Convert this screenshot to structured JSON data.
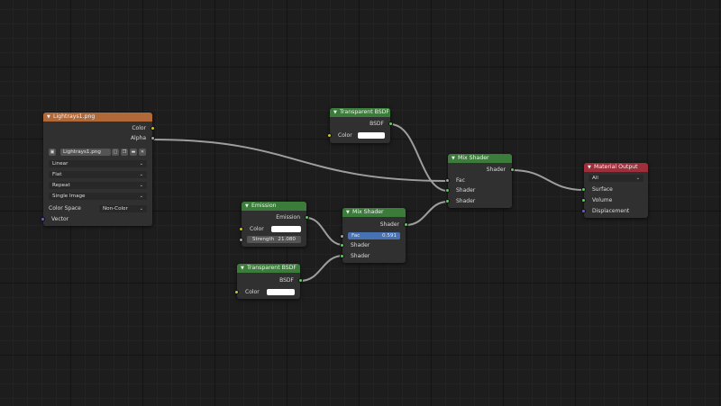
{
  "image_node": {
    "title": "Lightrays1.png",
    "outputs": [
      "Color",
      "Alpha"
    ],
    "image_name": "Lightrays1.png",
    "interpolation": "Linear",
    "projection": "Flat",
    "extension": "Repeat",
    "source": "Single Image",
    "color_space_label": "Color Space",
    "color_space": "Non-Color",
    "input": "Vector"
  },
  "transparent_top": {
    "title": "Transparent BSDF",
    "output": "BSDF",
    "input": "Color"
  },
  "emission": {
    "title": "Emission",
    "output": "Emission",
    "color_label": "Color",
    "strength_label": "Strength",
    "strength_value": "21.080"
  },
  "transparent_bottom": {
    "title": "Transparent BSDF",
    "output": "BSDF",
    "input": "Color"
  },
  "mix_small": {
    "title": "Mix Shader",
    "output": "Shader",
    "fac_label": "Fac",
    "fac_value": "0.591",
    "inputs": [
      "Shader",
      "Shader"
    ]
  },
  "mix_big": {
    "title": "Mix Shader",
    "output": "Shader",
    "inputs": [
      "Fac",
      "Shader",
      "Shader"
    ]
  },
  "material_output": {
    "title": "Material Output",
    "target": "All",
    "inputs": [
      "Surface",
      "Volume",
      "Displacement"
    ]
  },
  "colors": {
    "shader_header": "#3b7c3b",
    "texture_header": "#b1693a",
    "output_header": "#9d2f3b"
  }
}
